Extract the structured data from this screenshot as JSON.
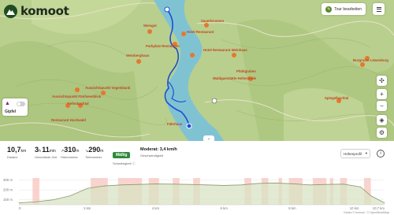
{
  "app": {
    "logo_text": "komoot"
  },
  "toolbar": {
    "tour_edit_label": "Tour bearbeiten",
    "menu_icon": "hamburger-icon"
  },
  "colors": {
    "brand": "#1f4d1f",
    "accent": "#5b8a2a",
    "river": "#7fc3d3",
    "route": "#1f4fd0",
    "difficulty": "#2e8a3a"
  },
  "map": {
    "labels": [
      "Hotel Restaurant",
      "Parkplatz Restaurant",
      "Hotel Restaurant Weinhaus",
      "Weingut",
      "Sauerbrunnen",
      "Aussichtspunkt Vogelsbank",
      "Aussichtspunkt Fünfseenblick",
      "Tiefenbachtal",
      "Restaurant Hochwald",
      "Waldgaststätte Hohenlinde",
      "Fährhaus",
      "Burgruine Löwenburg",
      "Pfahlgraben",
      "Spiegelbachtal",
      "Weinberghaus"
    ],
    "layer_toggle_label": "Gipfel",
    "controls": [
      "compass-icon",
      "zoom-in-icon",
      "zoom-out-icon",
      "layers-icon",
      "tools-icon"
    ]
  },
  "stats": {
    "distance_value": "10,7",
    "distance_unit": "km",
    "distance_label": "Distanz",
    "time_h": "3",
    "time_min": "11",
    "time_label": "Geschätzte Zeit",
    "up_value": "310",
    "up_unit": "m",
    "up_label": "Höhenmeter",
    "down_value": "290",
    "down_unit": "m",
    "down_label": "Tiefenmeter",
    "difficulty_value": "Mäßig",
    "difficulty_label": "Schwierigkeit",
    "speed_value": "Moderat: 3,4 km/h",
    "speed_label": "Geschwindigkeit"
  },
  "profile": {
    "select_label": "Höhenprofil",
    "info_icon": "info-icon"
  },
  "chart_data": {
    "type": "area",
    "x": [
      0,
      0.5,
      1,
      1.5,
      2,
      2.5,
      3,
      3.5,
      4,
      4.5,
      5,
      5.5,
      6,
      6.5,
      7,
      7.5,
      8,
      8.5,
      9,
      9.5,
      10,
      10.3,
      10.7
    ],
    "y": [
      70,
      80,
      100,
      140,
      215,
      240,
      250,
      255,
      260,
      258,
      255,
      250,
      245,
      250,
      265,
      270,
      262,
      250,
      255,
      258,
      230,
      140,
      70
    ],
    "y_ticks": [
      "300 m",
      "200 m",
      "100 m"
    ],
    "x_ticks": [
      "0",
      "2 km",
      "4 km",
      "6 km",
      "8 km",
      "10 km",
      "10,7 km"
    ],
    "ylim": [
      50,
      320
    ],
    "xlim": [
      0,
      10.7
    ],
    "surface_warning_segments": [
      [
        0.4,
        0.6
      ],
      [
        2.1,
        2.6
      ],
      [
        2.9,
        3.6
      ],
      [
        3.8,
        4.1
      ],
      [
        4.5,
        4.7
      ],
      [
        5.1,
        5.3
      ],
      [
        6.6,
        6.8
      ],
      [
        7.1,
        7.3
      ],
      [
        7.6,
        7.7
      ],
      [
        7.9,
        8.3
      ],
      [
        8.6,
        9.0
      ],
      [
        9.1,
        9.2
      ],
      [
        9.4,
        9.6
      ],
      [
        10.1,
        10.3
      ]
    ]
  },
  "footer": {
    "attribution": "Karten © komoot · © OpenStreetMap"
  }
}
